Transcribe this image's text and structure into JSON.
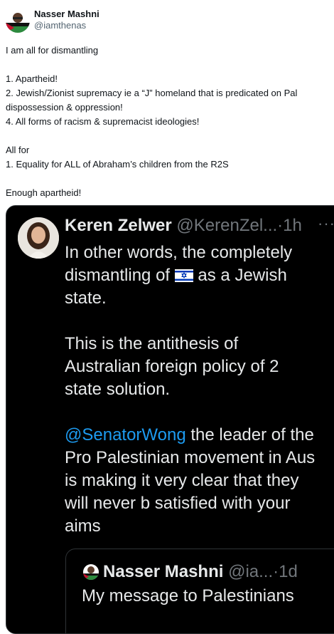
{
  "tweet": {
    "author_name": "Nasser Mashni",
    "author_handle": "@iamthenas",
    "lines": [
      "I am all for dismantling",
      "",
      "1. Apartheid!",
      "2. Jewish/Zionist supremacy ie a “J” homeland that is predicated on Pal",
      "dispossession & oppression!",
      "4. All forms of racism & supremacist ideologies!",
      "",
      "All for",
      "1. Equality for ALL of Abraham’s children from the R2S",
      "",
      "Enough apartheid!"
    ]
  },
  "quoted": {
    "author_name": "Keren Zelwer",
    "author_handle": "@KerenZel...",
    "time": "1h",
    "more_icon": "more-dots-icon",
    "text": {
      "l1": "In other words, the completely",
      "l2a": "dismantling of ",
      "l2_flag": "flag-israel-icon",
      "l2b": " as a Jewish",
      "l3": "state.",
      "l4": "This is the antithesis of",
      "l5": "Australian foreign policy of 2",
      "l6": "state solution.",
      "mention": "@SenatorWong",
      "l7": " the leader of the",
      "l8": "Pro Palestinian movement in Aus",
      "l9": "is making it very clear that they",
      "l10": "will never b satisfied with your",
      "l11": "aims"
    }
  },
  "nested": {
    "author_name": "Nasser Mashni",
    "author_handle": "@ia...",
    "time": "1d",
    "text": "My message to Palestinians"
  },
  "colors": {
    "link": "#1d9bf0",
    "dark_bg": "#000000",
    "secondary": "#71767b"
  }
}
